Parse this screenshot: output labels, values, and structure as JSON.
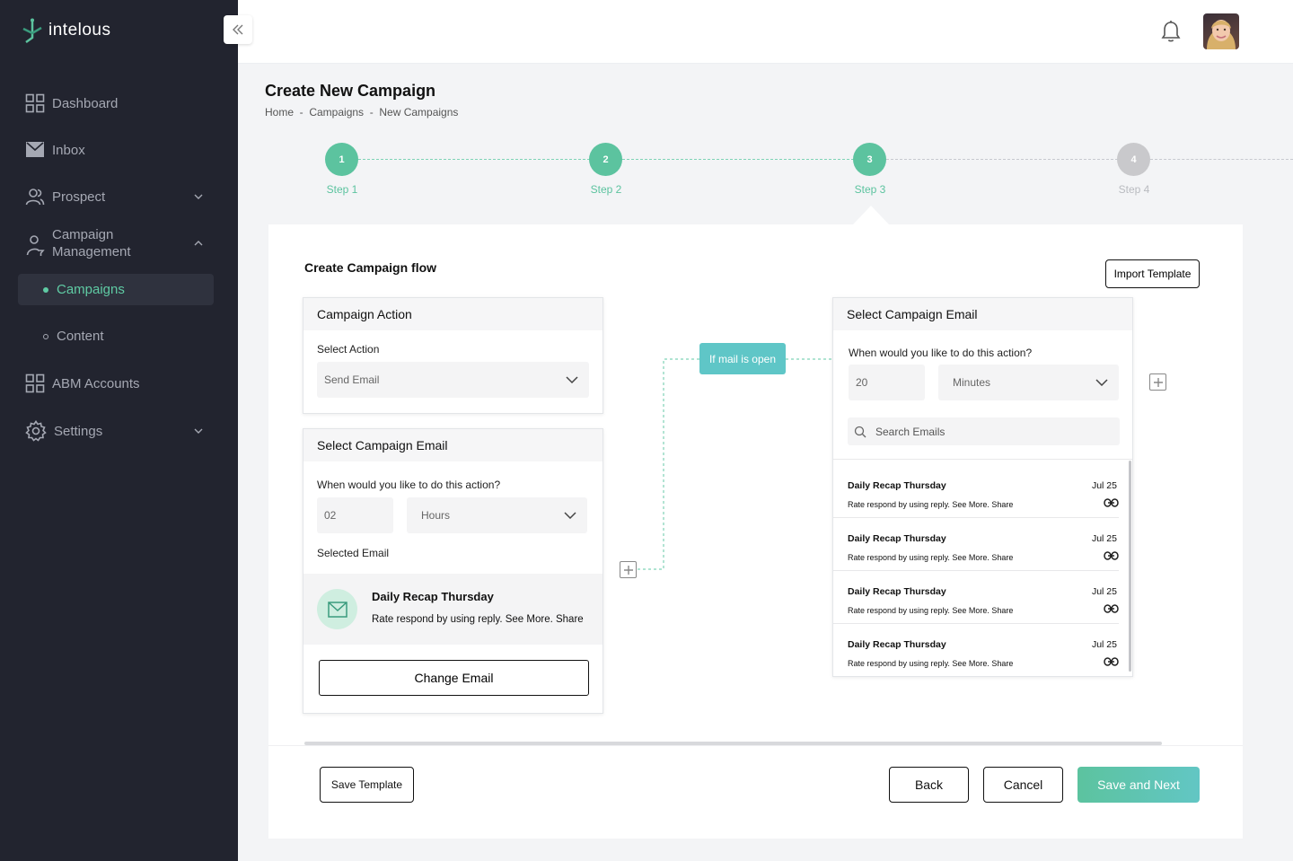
{
  "app": {
    "name": "intelous",
    "brand_color": "#5cc39f",
    "sidebar_bg": "#22242f"
  },
  "sidebar": {
    "items": [
      {
        "label": "Dashboard",
        "icon": "grid-icon"
      },
      {
        "label": "Inbox",
        "icon": "mail-icon"
      },
      {
        "label": "Prospect",
        "icon": "users-icon"
      },
      {
        "label": "Campaign Management",
        "line1": "Campaign",
        "line2": "Management",
        "icon": "campaign-user-icon"
      },
      {
        "label": "ABM Accounts",
        "icon": "grid-icon"
      },
      {
        "label": "Settings",
        "icon": "gear-icon"
      }
    ],
    "sub_items": [
      {
        "label": "Campaigns",
        "active": true
      },
      {
        "label": "Content",
        "active": false
      }
    ]
  },
  "header": {
    "title": "Create New Campaign",
    "breadcrumb": "Home  -  Campaigns  -  New Campaigns"
  },
  "steps": [
    {
      "number": "1",
      "label": "Step 1",
      "state": "done"
    },
    {
      "number": "2",
      "label": "Step 2",
      "state": "done"
    },
    {
      "number": "3",
      "label": "Step 3",
      "state": "current"
    },
    {
      "number": "4",
      "label": "Step 4",
      "state": "pending"
    }
  ],
  "flow": {
    "title": "Create Campaign flow",
    "import_label": "Import Template",
    "action_panel": {
      "title": "Campaign Action",
      "select_label": "Select Action",
      "select_value": "Send Email"
    },
    "email_panel": {
      "title": "Select Campaign Email",
      "when_label": "When would you like to do this action?",
      "delay_value": "02",
      "delay_unit": "Hours",
      "selected_label": "Selected Email",
      "selected_subject": "Daily Recap Thursday",
      "selected_snippet": "Rate respond by using reply. See More. Share",
      "change_label": "Change Email"
    },
    "condition_label": "If mail is open",
    "right_panel": {
      "title": "Select Campaign Email",
      "when_label": "When would you like to do this action?",
      "delay_value": "20",
      "delay_unit": "Minutes",
      "search_placeholder": "Search Emails",
      "emails": [
        {
          "subject": "Daily Recap Thursday",
          "date": "Jul 25",
          "snippet": "Rate respond by using reply. See More. Share"
        },
        {
          "subject": "Daily Recap Thursday",
          "date": "Jul 25",
          "snippet": "Rate respond by using reply. See More. Share"
        },
        {
          "subject": "Daily Recap Thursday",
          "date": "Jul 25",
          "snippet": "Rate respond by using reply. See More. Share"
        },
        {
          "subject": "Daily Recap Thursday",
          "date": "Jul 25",
          "snippet": "Rate respond by using reply. See More. Share"
        }
      ]
    }
  },
  "footer": {
    "save_template": "Save Template",
    "back": "Back",
    "cancel": "Cancel",
    "save_next": "Save and Next"
  }
}
